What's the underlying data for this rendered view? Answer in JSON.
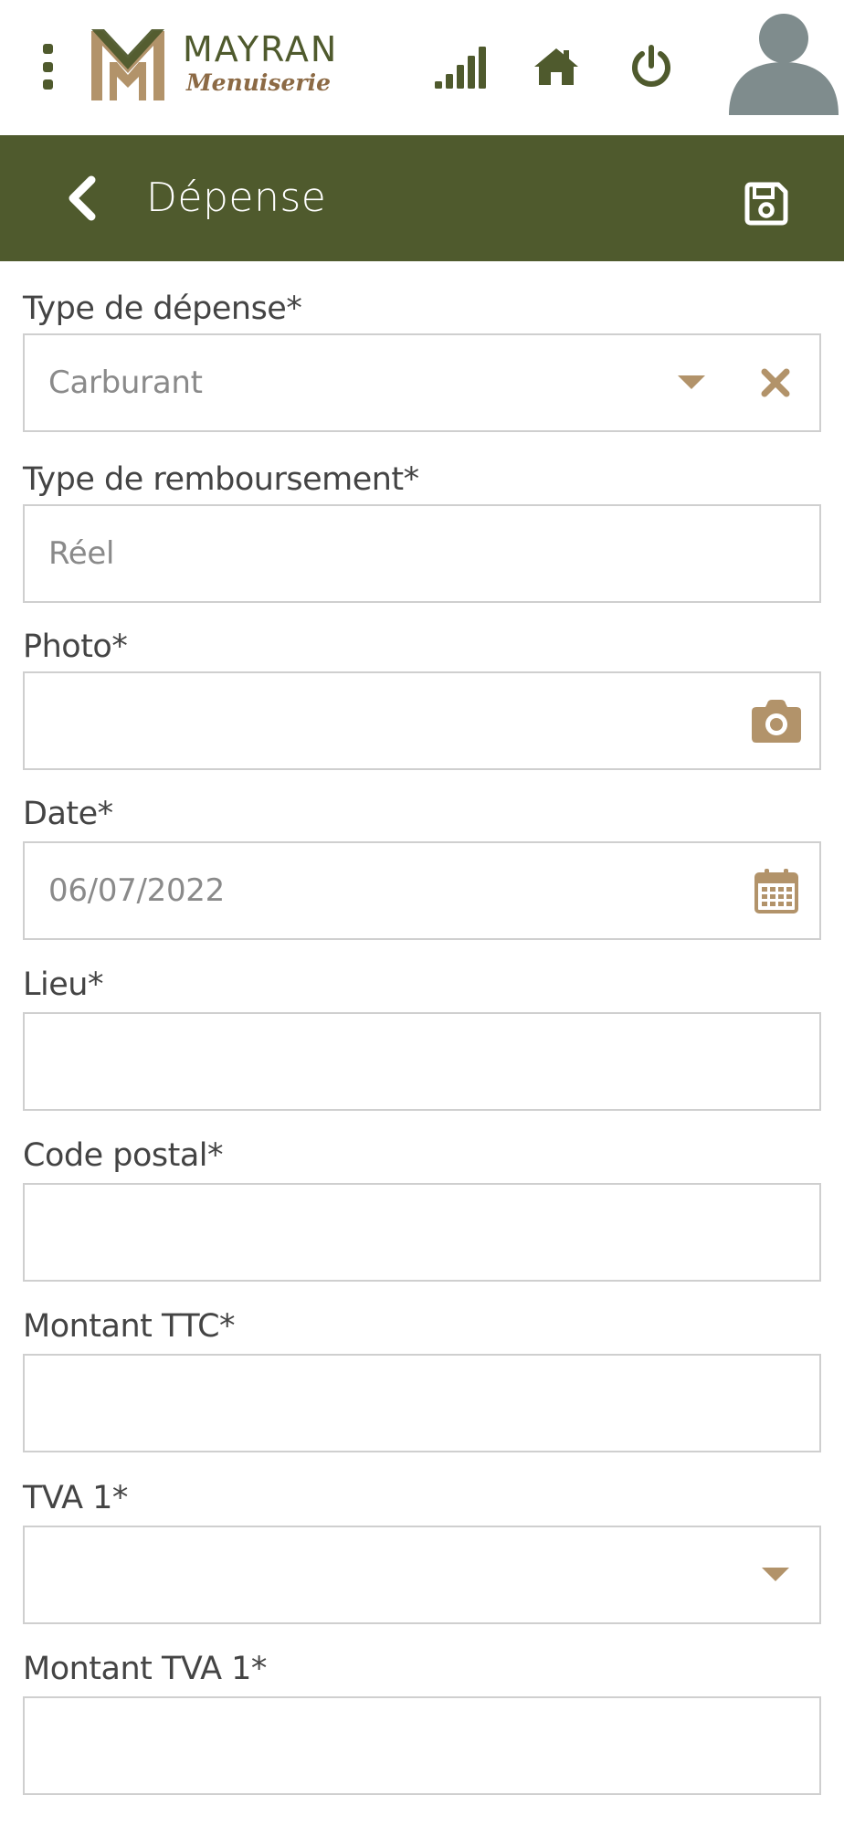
{
  "brand": {
    "name": "MAYRAN",
    "subtitle": "Menuiserie"
  },
  "header": {
    "icons": [
      "kebab-menu-icon",
      "signal-icon",
      "home-icon",
      "power-icon",
      "user-avatar-icon"
    ]
  },
  "titlebar": {
    "title": "Dépense",
    "back_icon": "chevron-left-icon",
    "save_icon": "floppy-disk-icon"
  },
  "form": {
    "fields": [
      {
        "label": "Type de dépense*",
        "value": "Carburant",
        "type": "select-clearable"
      },
      {
        "label": "Type de remboursement*",
        "value": "Réel",
        "type": "text"
      },
      {
        "label": "Photo*",
        "value": "",
        "type": "photo"
      },
      {
        "label": "Date*",
        "value": "06/07/2022",
        "type": "date"
      },
      {
        "label": "Lieu*",
        "value": "",
        "type": "text"
      },
      {
        "label": "Code postal*",
        "value": "",
        "type": "text"
      },
      {
        "label": "Montant TTC*",
        "value": "",
        "type": "text"
      },
      {
        "label": "TVA 1*",
        "value": "",
        "type": "select"
      },
      {
        "label": "Montant TVA 1*",
        "value": "",
        "type": "text"
      }
    ]
  },
  "colors": {
    "primary": "#4f5a2d",
    "accent": "#b2936a",
    "avatar": "#7f8c8d",
    "border": "#cfcfcf",
    "label_text": "#444444",
    "value_text": "#8a8a8a"
  }
}
